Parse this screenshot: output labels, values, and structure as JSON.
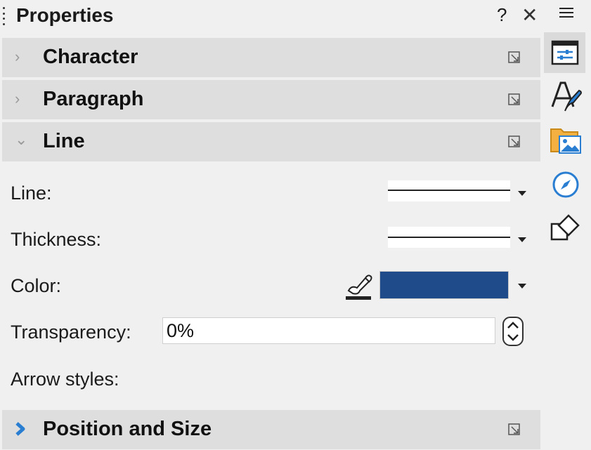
{
  "panel": {
    "title": "Properties",
    "help_label": "?",
    "close_label": "✕"
  },
  "sections": {
    "character": {
      "label": "Character",
      "expanded": false
    },
    "paragraph": {
      "label": "Paragraph",
      "expanded": false
    },
    "line": {
      "label": "Line",
      "expanded": true
    },
    "position_size": {
      "label": "Position and Size",
      "expanded": false
    }
  },
  "line_section": {
    "line_label": "Line:",
    "thickness_label": "Thickness:",
    "color_label": "Color:",
    "transparency_label": "Transparency:",
    "transparency_value": "0%",
    "arrow_styles_label": "Arrow styles:",
    "color_value": "#1f4b8a"
  },
  "sidebar_tabs": {
    "menu_icon": "hamburger-menu-icon",
    "items": [
      {
        "name": "properties",
        "icon": "properties-icon",
        "active": true
      },
      {
        "name": "styles",
        "icon": "styles-icon",
        "active": false
      },
      {
        "name": "gallery",
        "icon": "gallery-icon",
        "active": false
      },
      {
        "name": "navigator",
        "icon": "navigator-icon",
        "active": false
      },
      {
        "name": "shapes",
        "icon": "shapes-icon",
        "active": false
      }
    ]
  },
  "colors": {
    "accent": "#2a7ed2",
    "header_bg": "#dedede",
    "panel_bg": "#f0f0f0"
  }
}
